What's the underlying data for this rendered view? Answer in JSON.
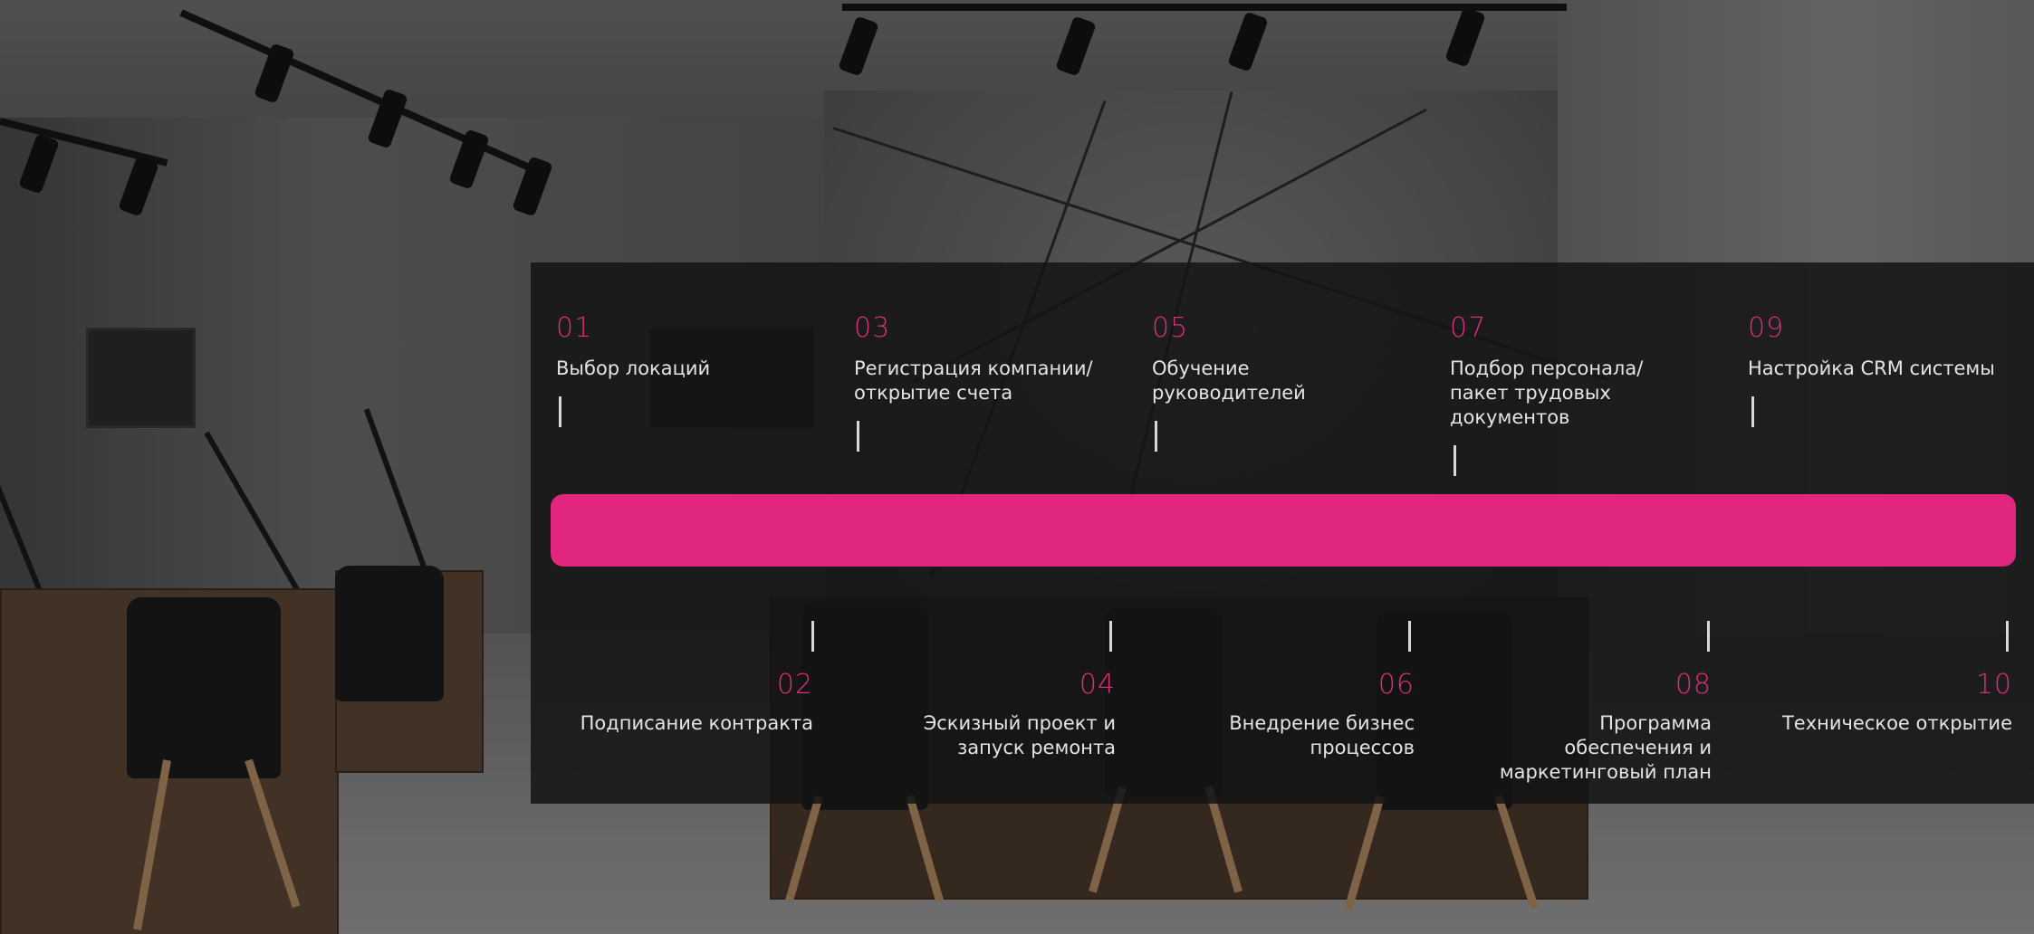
{
  "colors": {
    "accent": "#e0267f",
    "number": "#d92e7a",
    "text": "#e4e4e4",
    "panel": "rgba(20,20,20,0.86)"
  },
  "steps_top": [
    {
      "number": "01",
      "label": "Выбор локаций"
    },
    {
      "number": "03",
      "label": "Регистрация компании/\nоткрытие счета"
    },
    {
      "number": "05",
      "label": "Обучение\nруководителей"
    },
    {
      "number": "07",
      "label": "Подбор персонала/\nпакет трудовых\nдокументов"
    },
    {
      "number": "09",
      "label": "Настройка CRM системы"
    }
  ],
  "steps_bottom": [
    {
      "number": "02",
      "label": "Подписание контракта"
    },
    {
      "number": "04",
      "label": "Эскизный проект и\nзапуск ремонта"
    },
    {
      "number": "06",
      "label": "Внедрение бизнес\nпроцессов"
    },
    {
      "number": "08",
      "label": "Программа\nобеспечения и\nмаркетинговый план"
    },
    {
      "number": "10",
      "label": "Техническое открытие"
    }
  ]
}
